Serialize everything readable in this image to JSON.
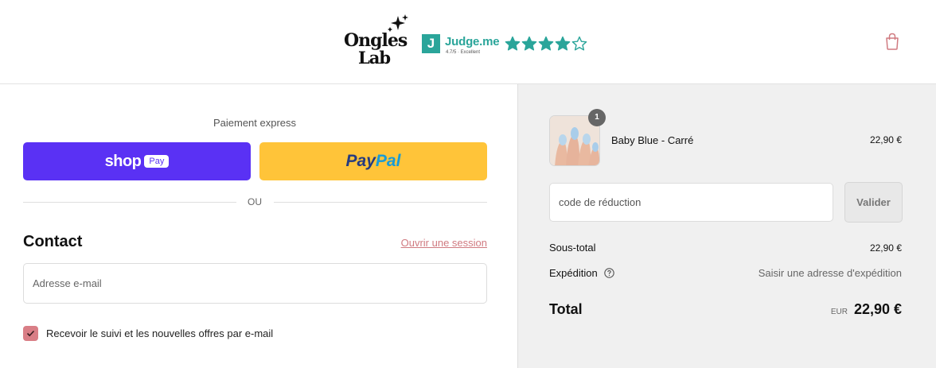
{
  "brand": {
    "logo_line1": "Ongles",
    "logo_line2": "Lab",
    "reviews_name": "Judge.me",
    "reviews_badge": "J",
    "reviews_sub": "4.7/5 · Excellent",
    "reviews_rating": 4,
    "reviews_max": 5,
    "accent": "#2aa59a"
  },
  "header": {
    "cart_icon": "shopping-bag-icon"
  },
  "express": {
    "title": "Paiement express",
    "shop_word": "shop",
    "shop_badge": "Pay",
    "paypal_a": "Pay",
    "paypal_b": "Pal",
    "divider_text": "OU"
  },
  "contact": {
    "title": "Contact",
    "login_link": "Ouvrir une session",
    "email_placeholder": "Adresse e-mail",
    "newsletter_label": "Recevoir le suivi et les nouvelles offres par e-mail",
    "newsletter_checked": true
  },
  "summary": {
    "item": {
      "name": "Baby Blue - Carré",
      "price": "22,90 €",
      "quantity": "1"
    },
    "discount_placeholder": "code de réduction",
    "apply_label": "Valider",
    "subtotal_label": "Sous-total",
    "subtotal_value": "22,90 €",
    "shipping_label": "Expédition",
    "shipping_value": "Saisir une adresse d'expédition",
    "total_label": "Total",
    "currency": "EUR",
    "total_value": "22,90 €"
  }
}
